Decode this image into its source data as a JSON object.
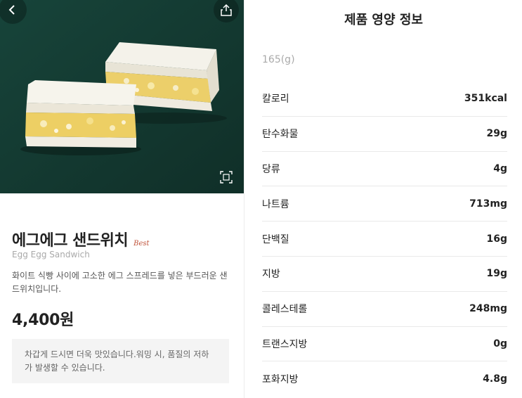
{
  "product": {
    "name_ko": "에그에그 샌드위치",
    "badge": "Best",
    "name_en": "Egg Egg Sandwich",
    "description": "화이트 식빵 사이에 고소한 에그 스프레드를 넣은 부드러운 샌드위치입니다.",
    "price": "4,400원",
    "notice": "차갑게 드시면 더욱 맛있습니다.워밍 시, 품질의 저하가 발생할 수 있습니다."
  },
  "nutrition": {
    "title": "제품 영양 정보",
    "serving": "165(g)",
    "items": [
      {
        "name": "칼로리",
        "value": "351kcal"
      },
      {
        "name": "탄수화물",
        "value": "29g"
      },
      {
        "name": "당류",
        "value": "4g"
      },
      {
        "name": "나트륨",
        "value": "713mg"
      },
      {
        "name": "단백질",
        "value": "16g"
      },
      {
        "name": "지방",
        "value": "19g"
      },
      {
        "name": "콜레스테롤",
        "value": "248mg"
      },
      {
        "name": "트랜스지방",
        "value": "0g"
      },
      {
        "name": "포화지방",
        "value": "4.8g"
      }
    ]
  },
  "icons": {
    "back": "chevron-left-icon",
    "share": "share-icon",
    "zoom": "expand-icon"
  },
  "colors": {
    "hero_background": "#143a32",
    "badge": "#c0533a",
    "notice_background": "#f4f4f4"
  }
}
